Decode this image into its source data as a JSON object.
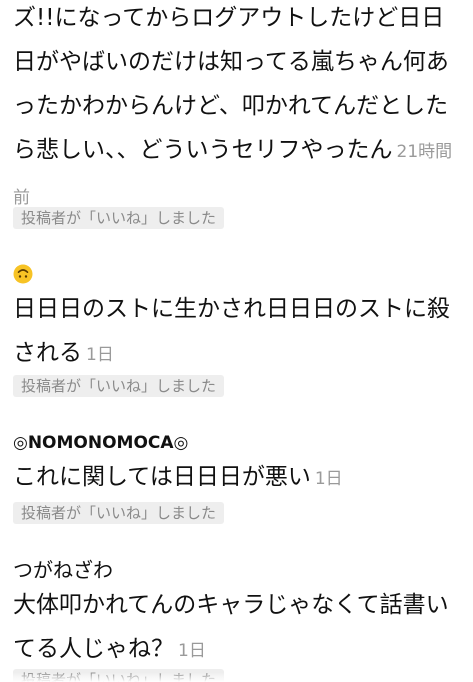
{
  "comments": [
    {
      "body": "ズ!!になってからログアウトしたけど日日日がやばいのだけは知ってる嵐ちゃん何あったかわからんけど、叩かれてんだとしたら悲しい、、どういうセリフやったん",
      "time": "21時間前",
      "liked_label": "投稿者が「いいね」しました"
    },
    {
      "author_icon": "upside-down-face-icon",
      "body": "日日日のストに生かされ日日日のストに殺される",
      "time": "1日",
      "liked_label": "投稿者が「いいね」しました"
    },
    {
      "author": "◎NOMONOMOCA◎",
      "body": "これに関しては日日日が悪い",
      "time": "1日",
      "liked_label": "投稿者が「いいね」しました"
    },
    {
      "author": "つがねざわ",
      "body": "大体叩かれてんのキャラじゃなくて話書いてる人じゃね？",
      "time": "1日",
      "liked_label": "投稿者が「いいね」しました"
    }
  ],
  "colors": {
    "text": "#111111",
    "timestamp": "#9a9a9a",
    "badge_bg": "#eeeeee",
    "badge_text": "#8a8a8a",
    "emoji": "#f7c325"
  }
}
